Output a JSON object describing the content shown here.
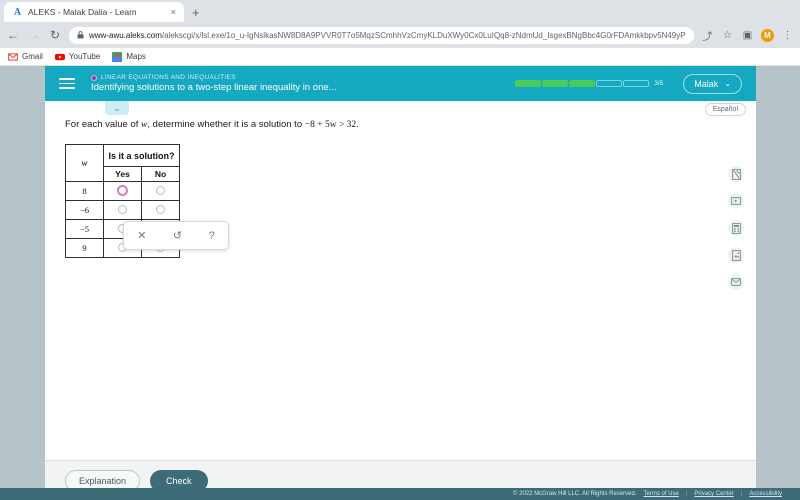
{
  "browser": {
    "tab": {
      "favicon": "A",
      "title": "ALEKS - Malak Dalia - Learn",
      "close": "×"
    },
    "new_tab": "+",
    "nav": {
      "back": "←",
      "forward": "→",
      "reload": "↻"
    },
    "url_host": "www-awu.aleks.com",
    "url_path": "/alekscgi/x/lsl.exe/1o_u-IgNslkasNW8D8A9PVVR0T7o5MqzSCmhhVzCmyKLDuXWy0Cx0LuIQq8-zNdmUd_IsgexBNgBbc4G0rFDAmkkbpv5N49yPv...",
    "toolbar_icons": {
      "share": "⤴",
      "bookmark": "☆",
      "panel": "▣",
      "menu": "⋮"
    },
    "profile_initial": "M",
    "bookmarks": [
      {
        "label": "Gmail",
        "icon": "gmail-icon"
      },
      {
        "label": "YouTube",
        "icon": "youtube-icon"
      },
      {
        "label": "Maps",
        "icon": "maps-icon"
      }
    ]
  },
  "aleks": {
    "kicker": "LINEAR EQUATIONS AND INEQUALITIES",
    "title": "Identifying solutions to a two-step linear inequality in one...",
    "progress": {
      "total": 5,
      "filled": 3,
      "label": "3/5"
    },
    "user": {
      "name": "Malak",
      "chevron": "⌄"
    },
    "espanol": "Español",
    "chevron_tab": "⌄"
  },
  "problem": {
    "prompt_pre": "For each value of ",
    "prompt_var": "w",
    "prompt_mid": ", determine whether it is a solution to ",
    "prompt_expr": "−8 + 5w > 32",
    "prompt_end": "."
  },
  "table": {
    "var_header": "w",
    "question_header": "Is it a solution?",
    "yes_header": "Yes",
    "no_header": "No",
    "rows": [
      {
        "value": "8",
        "yes_state": "hover",
        "no_state": "empty"
      },
      {
        "value": "−6",
        "yes_state": "empty",
        "no_state": "empty"
      },
      {
        "value": "−5",
        "yes_state": "empty",
        "no_state": "empty"
      },
      {
        "value": "9",
        "yes_state": "empty",
        "no_state": "empty"
      }
    ]
  },
  "toolpopup": {
    "clear": "✕",
    "undo": "↺",
    "help": "?"
  },
  "rail": [
    {
      "icon": "no-write-icon"
    },
    {
      "icon": "video-icon"
    },
    {
      "icon": "calculator-icon"
    },
    {
      "icon": "notepad-icon"
    },
    {
      "icon": "message-icon"
    }
  ],
  "actions": {
    "explanation": "Explanation",
    "check": "Check"
  },
  "footer": {
    "copyright": "© 2022 McGraw Hill LLC. All Rights Reserved.",
    "terms": "Terms of Use",
    "privacy": "Privacy Center",
    "accessibility": "Accessibility",
    "separator": "|"
  },
  "colors": {
    "aleks_teal": "#14a9c0",
    "progress_green": "#4cca5a",
    "check_button": "#3d6b77",
    "hover_radio": "#cf7fc0",
    "page_backdrop": "#b6c3c8"
  }
}
